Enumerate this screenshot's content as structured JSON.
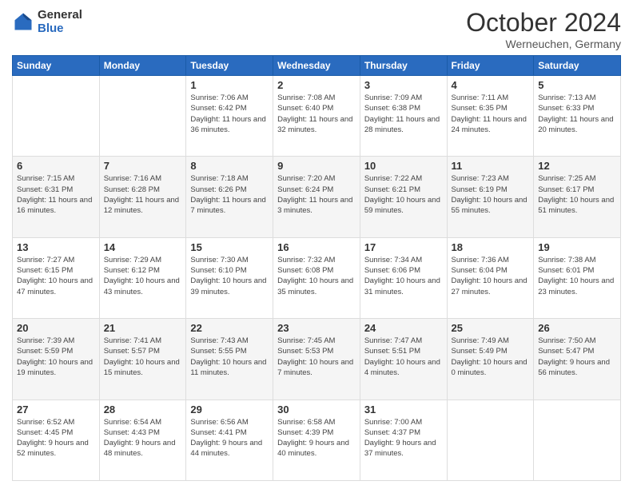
{
  "logo": {
    "line1": "General",
    "line2": "Blue"
  },
  "title": "October 2024",
  "subtitle": "Werneuchen, Germany",
  "days_header": [
    "Sunday",
    "Monday",
    "Tuesday",
    "Wednesday",
    "Thursday",
    "Friday",
    "Saturday"
  ],
  "weeks": [
    [
      {
        "day": "",
        "info": ""
      },
      {
        "day": "",
        "info": ""
      },
      {
        "day": "1",
        "info": "Sunrise: 7:06 AM\nSunset: 6:42 PM\nDaylight: 11 hours\nand 36 minutes."
      },
      {
        "day": "2",
        "info": "Sunrise: 7:08 AM\nSunset: 6:40 PM\nDaylight: 11 hours\nand 32 minutes."
      },
      {
        "day": "3",
        "info": "Sunrise: 7:09 AM\nSunset: 6:38 PM\nDaylight: 11 hours\nand 28 minutes."
      },
      {
        "day": "4",
        "info": "Sunrise: 7:11 AM\nSunset: 6:35 PM\nDaylight: 11 hours\nand 24 minutes."
      },
      {
        "day": "5",
        "info": "Sunrise: 7:13 AM\nSunset: 6:33 PM\nDaylight: 11 hours\nand 20 minutes."
      }
    ],
    [
      {
        "day": "6",
        "info": "Sunrise: 7:15 AM\nSunset: 6:31 PM\nDaylight: 11 hours\nand 16 minutes."
      },
      {
        "day": "7",
        "info": "Sunrise: 7:16 AM\nSunset: 6:28 PM\nDaylight: 11 hours\nand 12 minutes."
      },
      {
        "day": "8",
        "info": "Sunrise: 7:18 AM\nSunset: 6:26 PM\nDaylight: 11 hours\nand 7 minutes."
      },
      {
        "day": "9",
        "info": "Sunrise: 7:20 AM\nSunset: 6:24 PM\nDaylight: 11 hours\nand 3 minutes."
      },
      {
        "day": "10",
        "info": "Sunrise: 7:22 AM\nSunset: 6:21 PM\nDaylight: 10 hours\nand 59 minutes."
      },
      {
        "day": "11",
        "info": "Sunrise: 7:23 AM\nSunset: 6:19 PM\nDaylight: 10 hours\nand 55 minutes."
      },
      {
        "day": "12",
        "info": "Sunrise: 7:25 AM\nSunset: 6:17 PM\nDaylight: 10 hours\nand 51 minutes."
      }
    ],
    [
      {
        "day": "13",
        "info": "Sunrise: 7:27 AM\nSunset: 6:15 PM\nDaylight: 10 hours\nand 47 minutes."
      },
      {
        "day": "14",
        "info": "Sunrise: 7:29 AM\nSunset: 6:12 PM\nDaylight: 10 hours\nand 43 minutes."
      },
      {
        "day": "15",
        "info": "Sunrise: 7:30 AM\nSunset: 6:10 PM\nDaylight: 10 hours\nand 39 minutes."
      },
      {
        "day": "16",
        "info": "Sunrise: 7:32 AM\nSunset: 6:08 PM\nDaylight: 10 hours\nand 35 minutes."
      },
      {
        "day": "17",
        "info": "Sunrise: 7:34 AM\nSunset: 6:06 PM\nDaylight: 10 hours\nand 31 minutes."
      },
      {
        "day": "18",
        "info": "Sunrise: 7:36 AM\nSunset: 6:04 PM\nDaylight: 10 hours\nand 27 minutes."
      },
      {
        "day": "19",
        "info": "Sunrise: 7:38 AM\nSunset: 6:01 PM\nDaylight: 10 hours\nand 23 minutes."
      }
    ],
    [
      {
        "day": "20",
        "info": "Sunrise: 7:39 AM\nSunset: 5:59 PM\nDaylight: 10 hours\nand 19 minutes."
      },
      {
        "day": "21",
        "info": "Sunrise: 7:41 AM\nSunset: 5:57 PM\nDaylight: 10 hours\nand 15 minutes."
      },
      {
        "day": "22",
        "info": "Sunrise: 7:43 AM\nSunset: 5:55 PM\nDaylight: 10 hours\nand 11 minutes."
      },
      {
        "day": "23",
        "info": "Sunrise: 7:45 AM\nSunset: 5:53 PM\nDaylight: 10 hours\nand 7 minutes."
      },
      {
        "day": "24",
        "info": "Sunrise: 7:47 AM\nSunset: 5:51 PM\nDaylight: 10 hours\nand 4 minutes."
      },
      {
        "day": "25",
        "info": "Sunrise: 7:49 AM\nSunset: 5:49 PM\nDaylight: 10 hours\nand 0 minutes."
      },
      {
        "day": "26",
        "info": "Sunrise: 7:50 AM\nSunset: 5:47 PM\nDaylight: 9 hours\nand 56 minutes."
      }
    ],
    [
      {
        "day": "27",
        "info": "Sunrise: 6:52 AM\nSunset: 4:45 PM\nDaylight: 9 hours\nand 52 minutes."
      },
      {
        "day": "28",
        "info": "Sunrise: 6:54 AM\nSunset: 4:43 PM\nDaylight: 9 hours\nand 48 minutes."
      },
      {
        "day": "29",
        "info": "Sunrise: 6:56 AM\nSunset: 4:41 PM\nDaylight: 9 hours\nand 44 minutes."
      },
      {
        "day": "30",
        "info": "Sunrise: 6:58 AM\nSunset: 4:39 PM\nDaylight: 9 hours\nand 40 minutes."
      },
      {
        "day": "31",
        "info": "Sunrise: 7:00 AM\nSunset: 4:37 PM\nDaylight: 9 hours\nand 37 minutes."
      },
      {
        "day": "",
        "info": ""
      },
      {
        "day": "",
        "info": ""
      }
    ]
  ]
}
